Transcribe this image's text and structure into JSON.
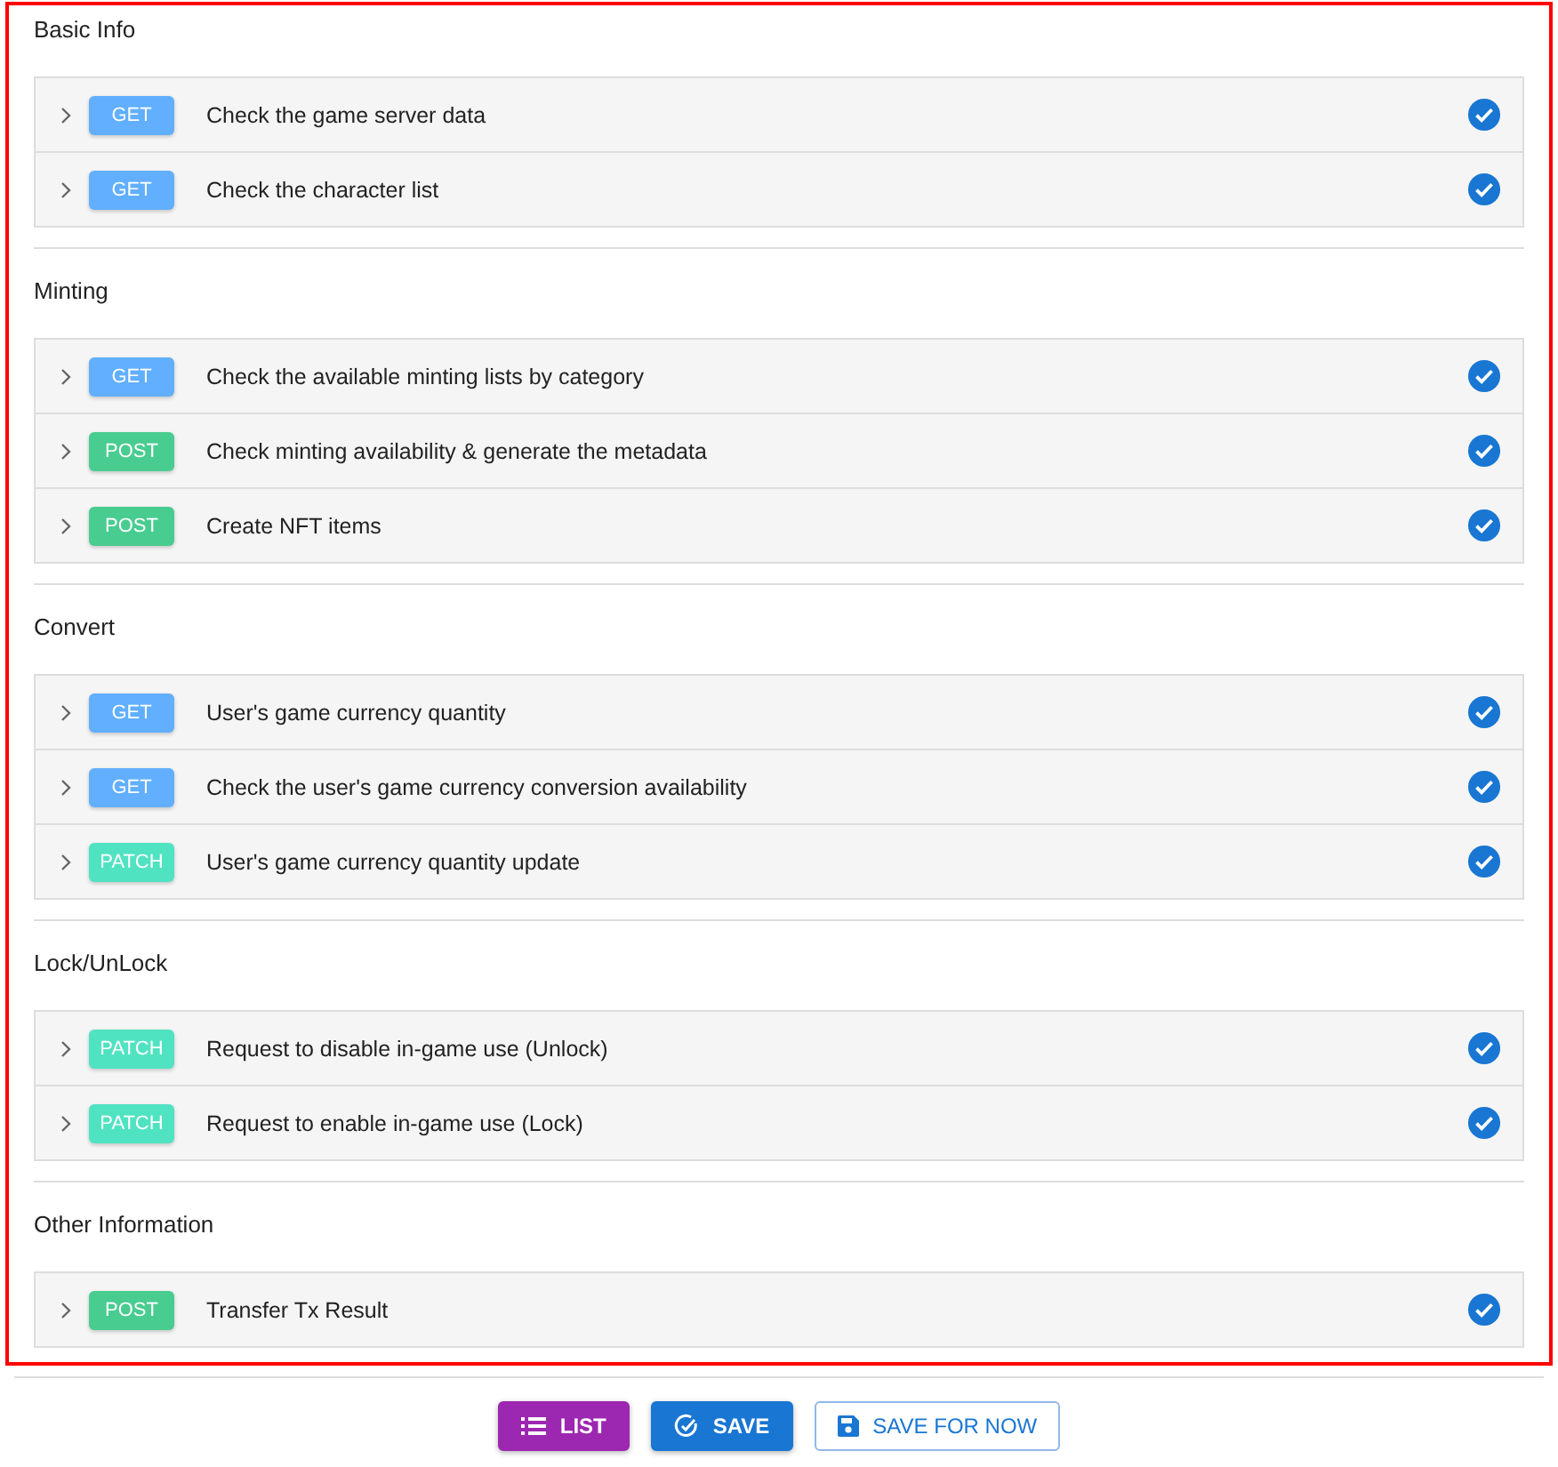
{
  "sections": [
    {
      "title": "Basic Info",
      "rows": [
        {
          "method": "GET",
          "color": "#61affe",
          "text": "Check the game server data",
          "checked": true
        },
        {
          "method": "GET",
          "color": "#61affe",
          "text": "Check the character list",
          "checked": true
        }
      ]
    },
    {
      "title": "Minting",
      "rows": [
        {
          "method": "GET",
          "color": "#61affe",
          "text": "Check the available minting lists by category",
          "checked": true
        },
        {
          "method": "POST",
          "color": "#49cc90",
          "text": "Check minting availability & generate the metadata",
          "checked": true
        },
        {
          "method": "POST",
          "color": "#49cc90",
          "text": "Create NFT items",
          "checked": true
        }
      ]
    },
    {
      "title": "Convert",
      "rows": [
        {
          "method": "GET",
          "color": "#61affe",
          "text": "User's game currency quantity",
          "checked": true
        },
        {
          "method": "GET",
          "color": "#61affe",
          "text": "Check the user's game currency conversion availability",
          "checked": true
        },
        {
          "method": "PATCH",
          "color": "#50e3c2",
          "text": "User's game currency quantity update",
          "checked": true
        }
      ]
    },
    {
      "title": "Lock/UnLock",
      "rows": [
        {
          "method": "PATCH",
          "color": "#50e3c2",
          "text": "Request to disable in-game use (Unlock)",
          "checked": true
        },
        {
          "method": "PATCH",
          "color": "#50e3c2",
          "text": "Request to enable in-game use (Lock)",
          "checked": true
        }
      ]
    },
    {
      "title": "Other Information",
      "rows": [
        {
          "method": "POST",
          "color": "#49cc90",
          "text": "Transfer Tx Result",
          "checked": true
        }
      ]
    }
  ],
  "buttons": [
    {
      "kind": "list",
      "label": "LIST"
    },
    {
      "kind": "save",
      "label": "SAVE"
    },
    {
      "kind": "draft",
      "label": "SAVE FOR NOW"
    }
  ]
}
